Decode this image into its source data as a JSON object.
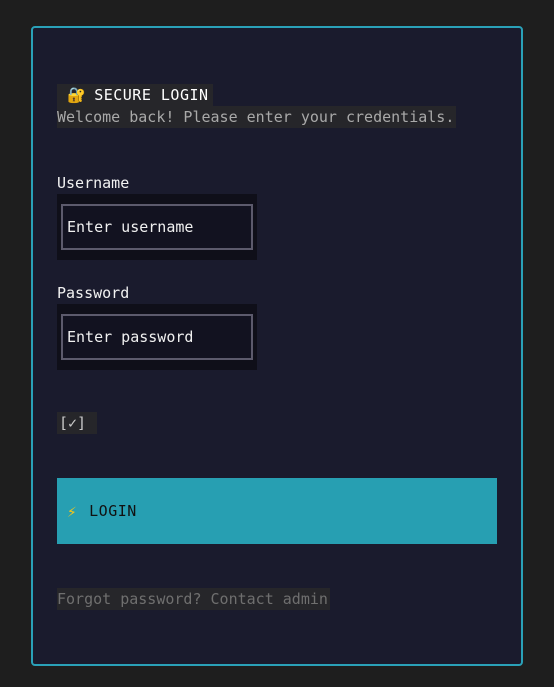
{
  "header": {
    "icon": "lock-with-key-icon",
    "icon_glyph": "🔐",
    "title": "SECURE LOGIN",
    "subtitle": "Welcome back! Please enter your credentials."
  },
  "username": {
    "label": "Username",
    "placeholder": "Enter username",
    "value": ""
  },
  "password": {
    "label": "Password",
    "placeholder": "Enter password",
    "value": ""
  },
  "remember": {
    "text": "[✓]",
    "checked": true
  },
  "login_button": {
    "icon": "lightning-bolt-icon",
    "icon_glyph": "⚡",
    "label": "LOGIN"
  },
  "footer": {
    "link_text": "Forgot password? Contact admin"
  },
  "colors": {
    "accent": "#2aa1b8",
    "card_background": "#1a1b2d",
    "page_background": "#1e1e1e"
  }
}
